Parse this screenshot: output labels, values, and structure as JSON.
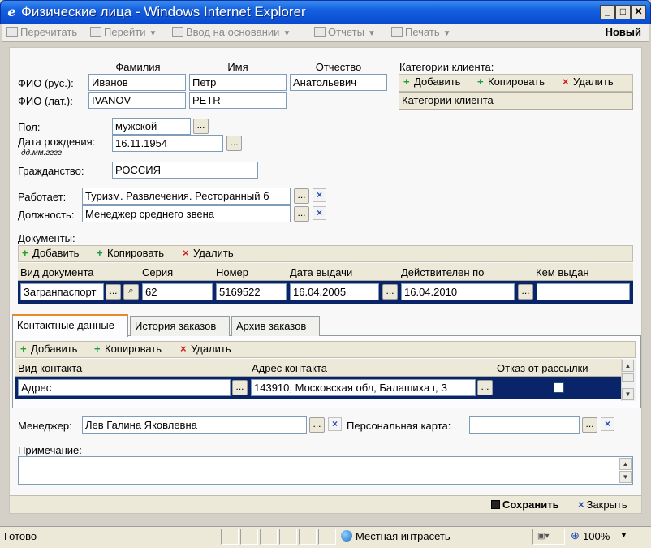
{
  "window": {
    "title": "Физические лица - Windows Internet Explorer",
    "icon": "ie-icon",
    "controls": [
      "_",
      "□",
      "✕"
    ]
  },
  "toolbar": {
    "reread": "Перечитать",
    "goto": "Перейти",
    "based_on": "Ввод на основании",
    "reports": "Отчеты",
    "print": "Печать",
    "new": "Новый",
    "arrow": "▼"
  },
  "fio": {
    "col_last": "Фамилия",
    "col_first": "Имя",
    "col_middle": "Отчество",
    "rus_label": "ФИО (рус.):",
    "lat_label": "ФИО (лат.):",
    "rus": {
      "last": "Иванов",
      "first": "Петр",
      "middle": "Анатольевич"
    },
    "lat": {
      "last": "IVANOV",
      "first": "PETR"
    }
  },
  "categories": {
    "title": "Категории клиента:",
    "add": "Добавить",
    "copy": "Копировать",
    "delete": "Удалить",
    "column": "Категории клиента"
  },
  "person": {
    "gender_label": "Пол:",
    "gender": "мужской",
    "birth_label": "Дата рождения:",
    "birth_hint": "дд.мм.гггг",
    "birth": "16.11.1954",
    "citizenship_label": "Гражданство:",
    "citizenship": "РОССИЯ",
    "works_label": "Работает:",
    "works": "Туризм. Развлечения. Ресторанный б",
    "position_label": "Должность:",
    "position": "Менеджер среднего звена"
  },
  "documents": {
    "title": "Документы:",
    "add": "Добавить",
    "copy": "Копировать",
    "delete": "Удалить",
    "columns": [
      "Вид документа",
      "Серия",
      "Номер",
      "Дата выдачи",
      "Действителен по",
      "Кем выдан"
    ],
    "row": {
      "type": "Загранпаспорт",
      "series": "62",
      "number": "5169522",
      "issued": "16.04.2005",
      "valid_until": "16.04.2010",
      "issued_by": ""
    }
  },
  "tabs": [
    "Контактные данные",
    "История заказов",
    "Архив заказов"
  ],
  "contacts": {
    "add": "Добавить",
    "copy": "Копировать",
    "delete": "Удалить",
    "columns": [
      "Вид контакта",
      "Адрес контакта",
      "Отказ от рассылки"
    ],
    "row": {
      "type": "Адрес",
      "address": "143910, Московская обл, Балашиха г, З",
      "unsubscribe": false
    }
  },
  "manager": {
    "label": "Менеджер:",
    "value": "Лев Галина Яковлевна",
    "card_label": "Персональная карта:",
    "card_value": ""
  },
  "note": {
    "label": "Примечание:",
    "value": ""
  },
  "footer": {
    "save": "Сохранить",
    "close": "Закрыть"
  },
  "dots": "...",
  "status": {
    "text": "Готово",
    "zone": "Местная интрасеть",
    "zoom": "100%"
  }
}
